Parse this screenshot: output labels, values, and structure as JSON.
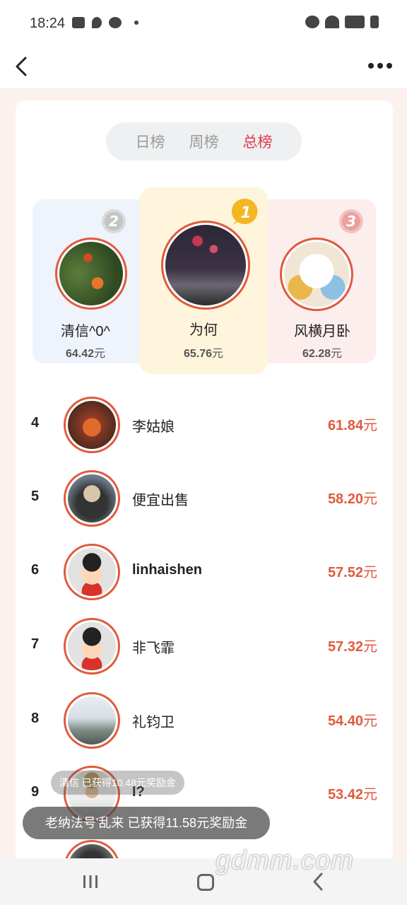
{
  "status_bar": {
    "time": "18:24"
  },
  "tabs": [
    {
      "label": "日榜",
      "active": false
    },
    {
      "label": "周榜",
      "active": false
    },
    {
      "label": "总榜",
      "active": true
    }
  ],
  "podium": {
    "first": {
      "rank": "1",
      "name": "为何",
      "amount": "65.76",
      "unit": "元"
    },
    "second": {
      "rank": "2",
      "name": "清信^0^",
      "amount": "64.42",
      "unit": "元"
    },
    "third": {
      "rank": "3",
      "name": "风横月卧",
      "amount": "62.28",
      "unit": "元"
    }
  },
  "rows": [
    {
      "rank": "4",
      "name": "李姑娘",
      "amount": "61.84",
      "unit": "元"
    },
    {
      "rank": "5",
      "name": "便宜出售",
      "amount": "58.20",
      "unit": "元"
    },
    {
      "rank": "6",
      "name": "linhaishen",
      "amount": "57.52",
      "unit": "元"
    },
    {
      "rank": "7",
      "name": "非飞霏",
      "amount": "57.32",
      "unit": "元"
    },
    {
      "rank": "8",
      "name": "礼钧卫",
      "amount": "54.40",
      "unit": "元"
    },
    {
      "rank": "9",
      "name": "l?",
      "amount": "53.42",
      "unit": "元"
    }
  ],
  "toasts": {
    "faded": "清信   已获得10.48元奖励金",
    "current": "老纳法号'乱来   已获得11.58元奖励金"
  },
  "watermark": "gdmm.com",
  "colors": {
    "accent": "#e05a3c",
    "active_tab": "#e0394a",
    "gold": "#f5b623"
  }
}
